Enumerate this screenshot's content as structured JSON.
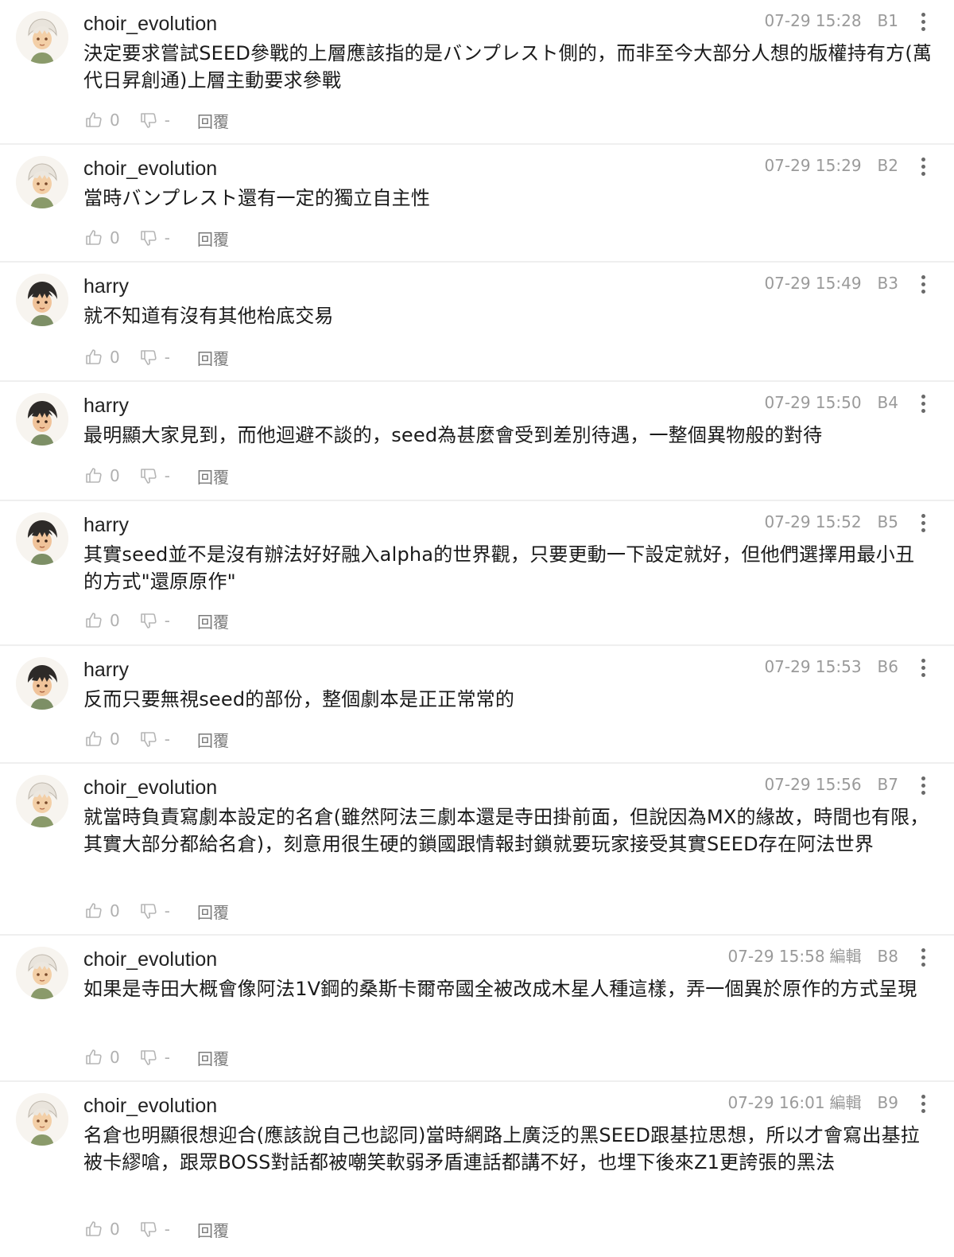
{
  "labels": {
    "reply": "回覆"
  },
  "icons": {
    "like": "thumbs-up-icon",
    "dislike": "thumbs-down-icon",
    "more": "more-vertical-icon"
  },
  "comments": [
    {
      "user": "choir_evolution",
      "avatar": "avatar-light",
      "time": "07-29 15:28",
      "edited": "",
      "floor": "B1",
      "text": "決定要求嘗試SEED參戰的上層應該指的是バンプレスト側的，而非至今大部分人想的版權持有方(萬代日昇創通)上層主動要求參戰",
      "likes": "0",
      "dislikes": "-"
    },
    {
      "user": "choir_evolution",
      "avatar": "avatar-light",
      "time": "07-29 15:29",
      "edited": "",
      "floor": "B2",
      "text": "當時バンプレスト還有一定的獨立自主性",
      "likes": "0",
      "dislikes": "-"
    },
    {
      "user": "harry",
      "avatar": "avatar-dark",
      "time": "07-29 15:49",
      "edited": "",
      "floor": "B3",
      "text": "就不知道有沒有其他枱底交易",
      "likes": "0",
      "dislikes": "-"
    },
    {
      "user": "harry",
      "avatar": "avatar-dark",
      "time": "07-29 15:50",
      "edited": "",
      "floor": "B4",
      "text": "最明顯大家見到，而他迴避不談的，seed為甚麼會受到差別待遇，一整個異物般的對待",
      "likes": "0",
      "dislikes": "-"
    },
    {
      "user": "harry",
      "avatar": "avatar-dark",
      "time": "07-29 15:52",
      "edited": "",
      "floor": "B5",
      "text": "其實seed並不是沒有辦法好好融入alpha的世界觀，只要更動一下設定就好，但他們選擇用最小丑的方式\"還原原作\"",
      "likes": "0",
      "dislikes": "-"
    },
    {
      "user": "harry",
      "avatar": "avatar-dark",
      "time": "07-29 15:53",
      "edited": "",
      "floor": "B6",
      "text": "反而只要無視seed的部份，整個劇本是正正常常的",
      "likes": "0",
      "dislikes": "-"
    },
    {
      "user": "choir_evolution",
      "avatar": "avatar-light",
      "time": "07-29 15:56",
      "edited": "",
      "floor": "B7",
      "text": "就當時負責寫劇本設定的名倉(雖然阿法三劇本還是寺田掛前面，但說因為MX的緣故，時間也有限，其實大部分都給名倉)，刻意用很生硬的鎖國跟情報封鎖就要玩家接受其實SEED存在阿法世界",
      "likes": "0",
      "dislikes": "-"
    },
    {
      "user": "choir_evolution",
      "avatar": "avatar-light",
      "time": "07-29 15:58",
      "edited": "編輯",
      "floor": "B8",
      "text": "如果是寺田大概會像阿法1V鋼的桑斯卡爾帝國全被改成木星人種這樣，弄一個異於原作的方式呈現",
      "likes": "0",
      "dislikes": "-"
    },
    {
      "user": "choir_evolution",
      "avatar": "avatar-light",
      "time": "07-29 16:01",
      "edited": "編輯",
      "floor": "B9",
      "text": "名倉也明顯很想迎合(應該說自己也認同)當時網路上廣泛的黑SEED跟基拉思想，所以才會寫出基拉被卡繆嗆，跟眾BOSS對話都被嘲笑軟弱矛盾連話都講不好，也埋下後來Z1更誇張的黑法",
      "likes": "0",
      "dislikes": "-"
    }
  ]
}
